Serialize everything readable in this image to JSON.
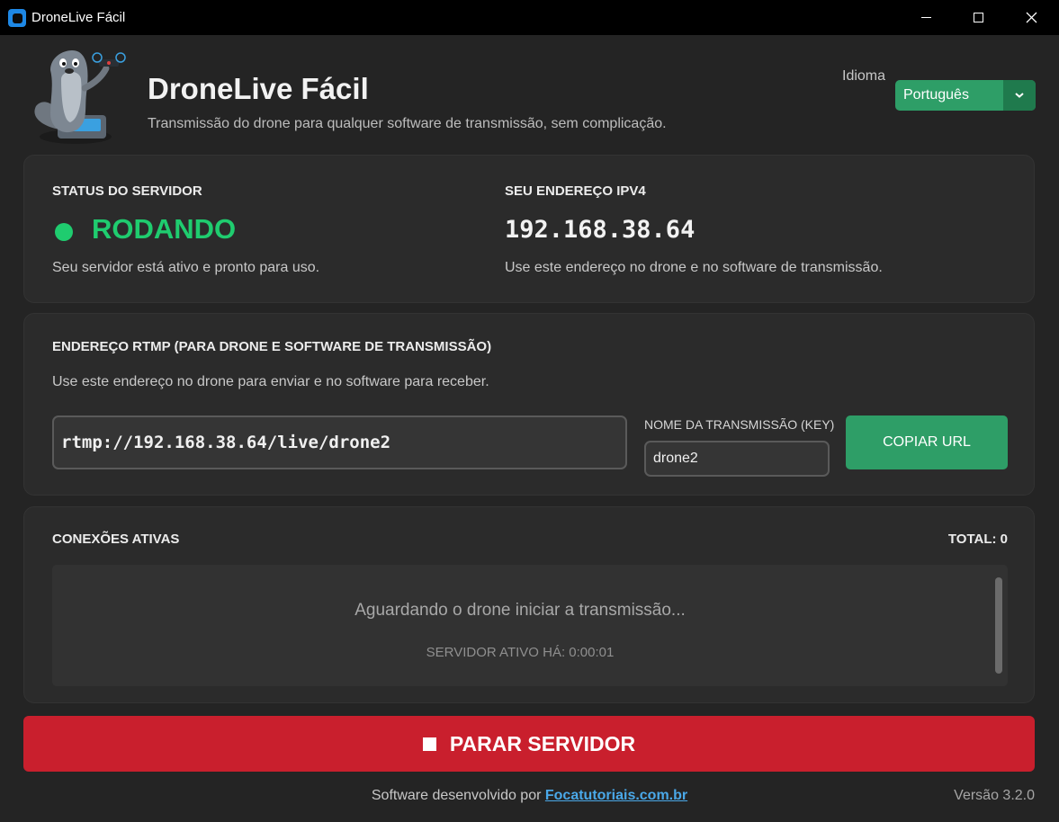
{
  "window": {
    "title": "DroneLive Fácil",
    "icon": "app-icon"
  },
  "header": {
    "title": "DroneLive Fácil",
    "subtitle": "Transmissão do drone para qualquer software de transmissão, sem complicação.",
    "language_label": "Idioma",
    "language_value": "Português"
  },
  "status": {
    "heading": "STATUS DO SERVIDOR",
    "value": "RODANDO",
    "description": "Seu servidor está ativo e pronto para uso.",
    "color": "#1fcc6f"
  },
  "ip": {
    "heading": "SEU ENDEREÇO IPV4",
    "value": "192.168.38.64",
    "description": "Use este endereço no drone e no software de transmissão."
  },
  "rtmp": {
    "heading": "ENDEREÇO RTMP (PARA DRONE E SOFTWARE DE TRANSMISSÃO)",
    "description": "Use este endereço no drone para enviar e no software para receber.",
    "url": "rtmp://192.168.38.64/live/drone2",
    "key_label": "NOME DA TRANSMISSÃO (KEY)",
    "key_value": "drone2",
    "copy_label": "COPIAR URL"
  },
  "connections": {
    "heading": "CONEXÕES ATIVAS",
    "total": "TOTAL: 0",
    "waiting": "Aguardando o drone iniciar a transmissão...",
    "uptime": "SERVIDOR ATIVO HÁ: 0:00:01"
  },
  "stop_button": {
    "label": "PARAR SERVIDOR",
    "color": "#c91f2d"
  },
  "footer": {
    "prefix": "Software desenvolvido por ",
    "link": "Focatutoriais.com.br",
    "version": "Versão 3.2.0"
  },
  "colors": {
    "accent_green": "#2e9e67",
    "link_blue": "#4aa8e8"
  }
}
